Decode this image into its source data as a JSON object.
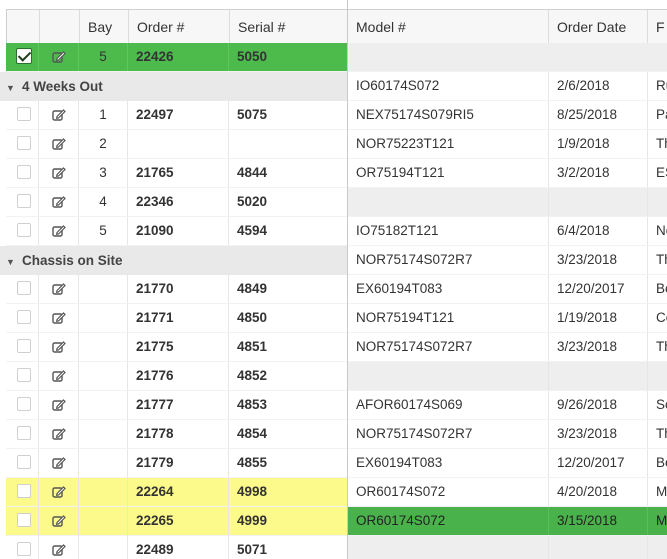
{
  "columns_left": [
    "",
    "",
    "Bay",
    "Order #",
    "Serial #"
  ],
  "columns_right": [
    "Model #",
    "Order Date",
    "F"
  ],
  "selected_row": {
    "bay": "5",
    "order": "22426",
    "serial": "5050"
  },
  "groups": [
    {
      "label": "4 Weeks Out",
      "model": "IO60174S072",
      "date": "2/6/2018",
      "f": "Ru"
    },
    {
      "label": "Chassis on Site",
      "model": "NOR75174S072R7",
      "date": "3/23/2018",
      "f": "Th"
    }
  ],
  "rows": [
    {
      "bay": "1",
      "order": "22497",
      "serial": "5075",
      "model": "NEX75174S079RI5",
      "date": "8/25/2018",
      "f": "Pa"
    },
    {
      "bay": "2",
      "order": "",
      "serial": "",
      "model": "NOR75223T121",
      "date": "1/9/2018",
      "f": "Th"
    },
    {
      "bay": "3",
      "order": "21765",
      "serial": "4844",
      "model": "OR75194T121",
      "date": "3/2/2018",
      "f": "ES"
    },
    {
      "bay": "4",
      "order": "22346",
      "serial": "5020",
      "model": "",
      "date": "",
      "f": ""
    },
    {
      "bay": "5",
      "order": "21090",
      "serial": "4594",
      "model": "IO75182T121",
      "date": "6/4/2018",
      "f": "No"
    },
    {
      "bay": "",
      "order": "21770",
      "serial": "4849",
      "model": "EX60194T083",
      "date": "12/20/2017",
      "f": "Be"
    },
    {
      "bay": "",
      "order": "21771",
      "serial": "4850",
      "model": "NOR75194T121",
      "date": "1/19/2018",
      "f": "Ce"
    },
    {
      "bay": "",
      "order": "21775",
      "serial": "4851",
      "model": "NOR75174S072R7",
      "date": "3/23/2018",
      "f": "Th"
    },
    {
      "bay": "",
      "order": "21776",
      "serial": "4852",
      "model": "",
      "date": "",
      "f": ""
    },
    {
      "bay": "",
      "order": "21777",
      "serial": "4853",
      "model": "AFOR60174S069",
      "date": "9/26/2018",
      "f": "So"
    },
    {
      "bay": "",
      "order": "21778",
      "serial": "4854",
      "model": "NOR75174S072R7",
      "date": "3/23/2018",
      "f": "Th"
    },
    {
      "bay": "",
      "order": "21779",
      "serial": "4855",
      "model": "EX60194T083",
      "date": "12/20/2017",
      "f": "Be"
    },
    {
      "bay": "",
      "order": "22264",
      "serial": "4998",
      "model": "OR60174S072",
      "date": "4/20/2018",
      "f": "Ma"
    },
    {
      "bay": "",
      "order": "22265",
      "serial": "4999",
      "model": "OR60174S072",
      "date": "3/15/2018",
      "f": "Ma"
    },
    {
      "bay": "",
      "order": "22489",
      "serial": "5071",
      "model": "",
      "date": "",
      "f": ""
    }
  ],
  "colors": {
    "selected": "#4cbb4c",
    "highlight": "#fcfa8a",
    "group": "#e9e9e9"
  },
  "icons": {
    "edit": "edit-icon",
    "checkbox": "checkbox",
    "collapse": "triangle-down-icon"
  }
}
